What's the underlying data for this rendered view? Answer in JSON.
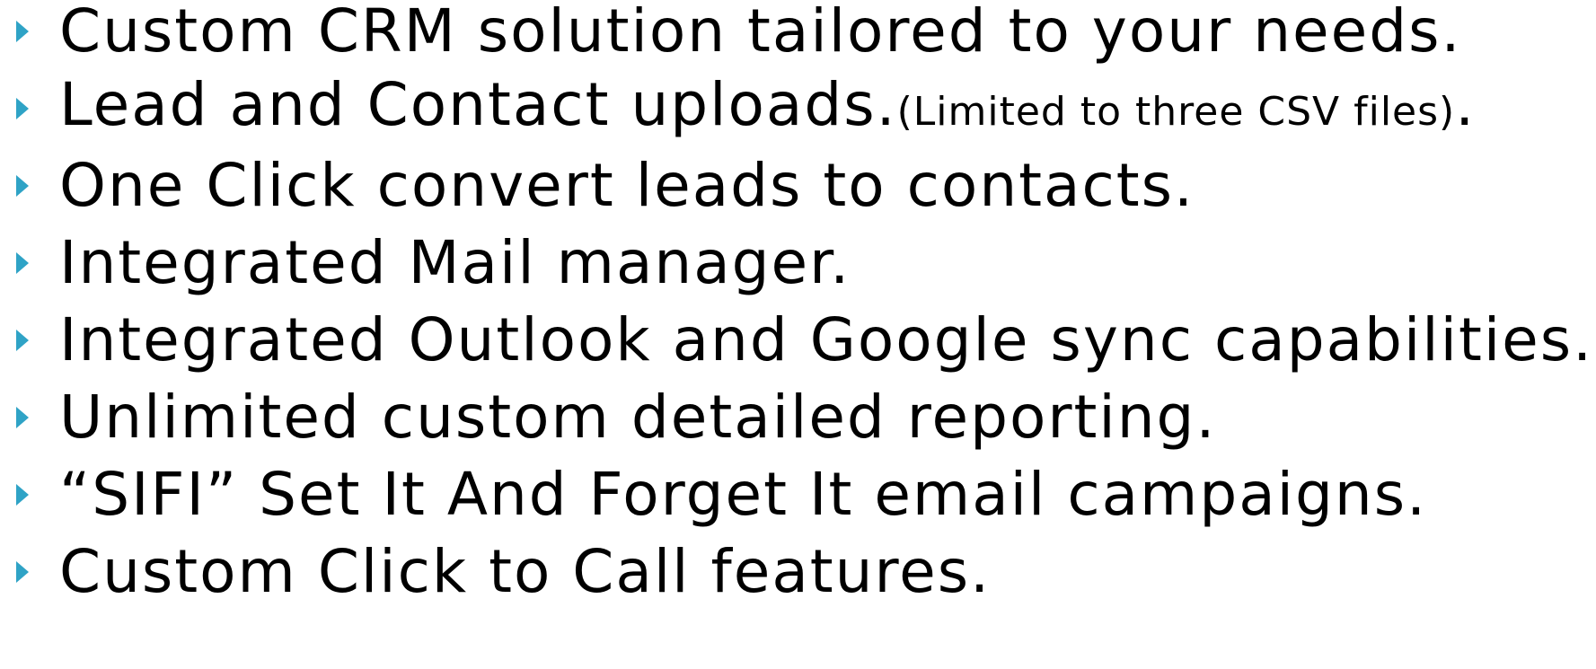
{
  "bullets": [
    {
      "text": "Custom CRM solution tailored to your needs.",
      "icon": "triangle-right-icon"
    },
    {
      "text": "Lead and Contact uploads.",
      "note": "(Limited to three CSV files)",
      "suffix": ".",
      "icon": "triangle-right-icon"
    },
    {
      "text": "One Click convert leads to contacts.",
      "icon": "triangle-right-icon"
    },
    {
      "text": "Integrated Mail manager.",
      "icon": "triangle-right-icon"
    },
    {
      "text": "Integrated Outlook and Google sync capabilities.",
      "icon": "triangle-right-icon"
    },
    {
      "text": "Unlimited custom detailed reporting.",
      "icon": "triangle-right-icon"
    },
    {
      "text": "“SIFI” Set It And Forget It email campaigns.",
      "icon": "triangle-right-icon"
    },
    {
      "text": "Custom Click to Call features.",
      "icon": "triangle-right-icon"
    }
  ],
  "colors": {
    "bullet": "#2fa3c6",
    "text": "#000000",
    "background": "#ffffff"
  }
}
